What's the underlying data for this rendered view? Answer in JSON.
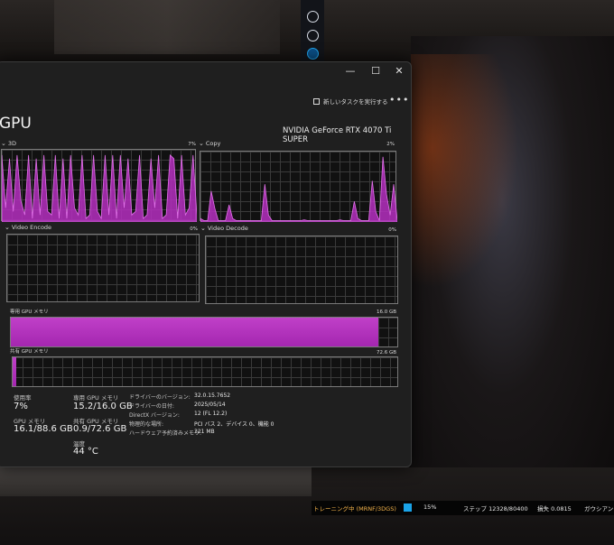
{
  "window": {
    "title": "GPU",
    "device_name": "NVIDIA GeForce RTX 4070 Ti SUPER",
    "new_task_label": "新しいタスクを実行する",
    "more_label": "•••",
    "minimize": "—",
    "maximize": "☐",
    "close": "✕",
    "accent_color": "#b52fbf"
  },
  "engines": [
    {
      "name": "3D",
      "value": "7%",
      "load": [
        0.95,
        0.2,
        0.9,
        0.15,
        0.95,
        0.3,
        0.1,
        0.95,
        0.05,
        0.9,
        0.1,
        0.95,
        0.15,
        0.1,
        0.95,
        0.05,
        0.9,
        0.05,
        0.95,
        0.2,
        0.1,
        0.95,
        0.05,
        0.1,
        0.95,
        0.15,
        0.05,
        0.95,
        0.1,
        0.95,
        0.05,
        0.95,
        0.2,
        0.9,
        0.1,
        0.15,
        0.95,
        0.05,
        0.1,
        0.9,
        0.2,
        0.95,
        0.05,
        0.1,
        0.95,
        0.9,
        0.05,
        0.95,
        0.1,
        0.2,
        0.95,
        0.1
      ]
    },
    {
      "name": "Copy",
      "value": "2%",
      "load": [
        0.05,
        0.02,
        0.02,
        0.45,
        0.2,
        0.02,
        0.02,
        0.02,
        0.25,
        0.05,
        0.02,
        0.02,
        0.02,
        0.02,
        0.02,
        0.02,
        0.02,
        0.02,
        0.55,
        0.1,
        0.02,
        0.02,
        0.02,
        0.02,
        0.02,
        0.02,
        0.02,
        0.02,
        0.02,
        0.03,
        0.02,
        0.02,
        0.02,
        0.02,
        0.02,
        0.02,
        0.02,
        0.02,
        0.02,
        0.03,
        0.02,
        0.02,
        0.02,
        0.3,
        0.05,
        0.02,
        0.02,
        0.02,
        0.6,
        0.15,
        0.02,
        0.95,
        0.4,
        0.1,
        0.55,
        0.02
      ]
    },
    {
      "name": "Video Encode",
      "value": "0%"
    },
    {
      "name": "Video Decode",
      "value": "0%"
    }
  ],
  "dedicated_memory": {
    "label": "専用 GPU メモリ",
    "max": "16.0 GB",
    "level": 0.95
  },
  "shared_memory": {
    "label": "共有 GPU メモリ",
    "max": "72.6 GB",
    "level": 0.01
  },
  "stats": {
    "utilization_label": "使用率",
    "utilization_value": "7%",
    "gpu_memory_label": "GPU メモリ",
    "gpu_memory_value": "16.1/88.6 GB",
    "dedicated_label": "専用 GPU メモリ",
    "dedicated_value": "15.2/16.0 GB",
    "shared_label": "共有 GPU メモリ",
    "shared_value": "0.9/72.6 GB",
    "temperature_label": "温度",
    "temperature_value": "44 °C"
  },
  "info": [
    {
      "key": "ドライバーのバージョン:",
      "value": "32.0.15.7652"
    },
    {
      "key": "ドライバーの日付:",
      "value": "2025/05/14"
    },
    {
      "key": "DirectX バージョン:",
      "value": "12 (FL 12.2)"
    },
    {
      "key": "物理的な場所:",
      "value": "PCI バス 2、デバイス 0、機能 0"
    },
    {
      "key": "ハードウェア予約済みメモリ:",
      "value": "321 MB"
    }
  ],
  "background_status": {
    "training": "トレーニング中 (MRNF/3DGS)",
    "percent": "15%",
    "step": "ステップ 12328/80400",
    "loss": "損失 0.0815",
    "gaussian": "ガウシアン"
  }
}
